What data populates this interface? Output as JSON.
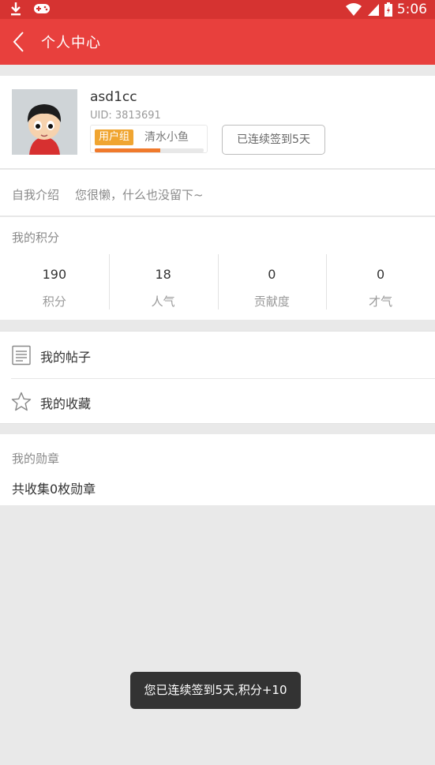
{
  "status_bar": {
    "time": "5:06"
  },
  "header": {
    "title": "个人中心"
  },
  "profile": {
    "username": "asd1cc",
    "uid": "UID: 3813691",
    "group_tag": "用户组",
    "group_name": "清水小鱼",
    "group_progress": 0.6,
    "checkin_label": "已连续签到5天"
  },
  "intro": {
    "label": "自我介绍",
    "text": "您很懒，什么也没留下~"
  },
  "points": {
    "title": "我的积分",
    "stats": [
      {
        "value": "190",
        "label": "积分"
      },
      {
        "value": "18",
        "label": "人气"
      },
      {
        "value": "0",
        "label": "贡献度"
      },
      {
        "value": "0",
        "label": "才气"
      }
    ]
  },
  "menu": {
    "items": [
      {
        "label": "我的帖子",
        "icon": "document-icon"
      },
      {
        "label": "我的收藏",
        "icon": "star-icon"
      }
    ]
  },
  "medals": {
    "title": "我的勋章",
    "count_text": "共收集0枚勋章"
  },
  "toast": {
    "text": "您已连续签到5天,积分+10"
  },
  "colors": {
    "header": "#e8403d",
    "group_tag": "#f0a531",
    "progress": "#f07a2c"
  }
}
